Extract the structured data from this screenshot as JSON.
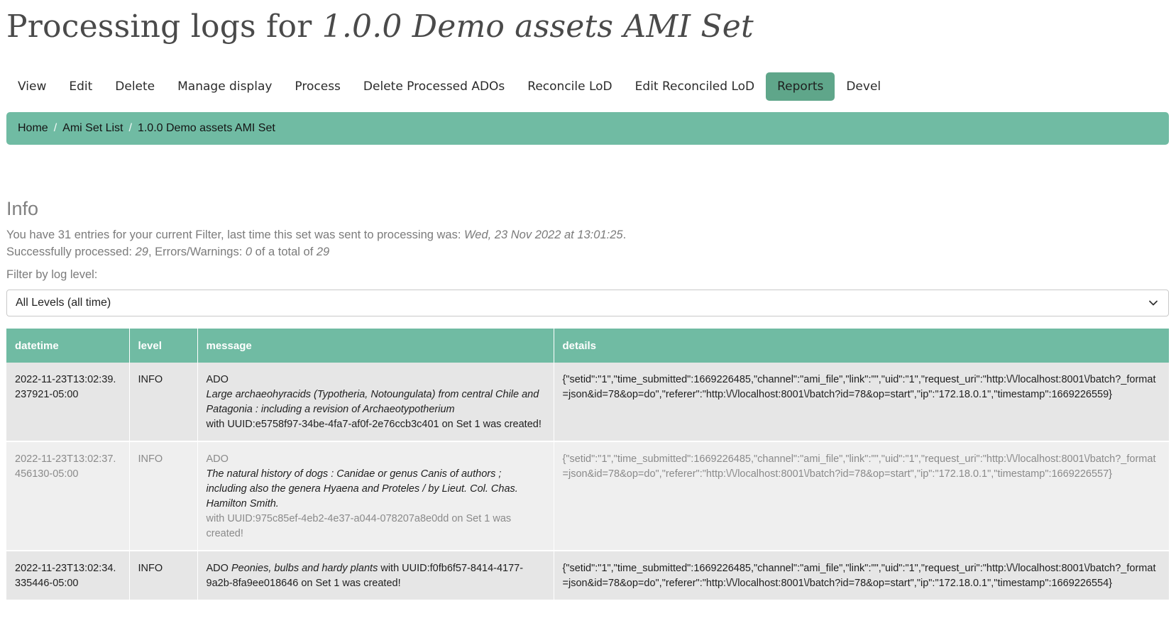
{
  "page": {
    "title_prefix": "Processing logs for ",
    "title_name": "1.0.0 Demo assets AMI Set"
  },
  "tabs": [
    {
      "label": "View"
    },
    {
      "label": "Edit"
    },
    {
      "label": "Delete"
    },
    {
      "label": "Manage display"
    },
    {
      "label": "Process"
    },
    {
      "label": "Delete Processed ADOs"
    },
    {
      "label": "Reconcile LoD"
    },
    {
      "label": "Edit Reconciled LoD"
    },
    {
      "label": "Reports",
      "active": true
    },
    {
      "label": "Devel"
    }
  ],
  "breadcrumb": {
    "items": [
      "Home",
      "Ami Set List",
      "1.0.0 Demo assets AMI Set"
    ],
    "separator": "/"
  },
  "info": {
    "heading": "Info",
    "line1_prefix": "You have 31 entries for your current Filter, last time this set was sent to processing was: ",
    "line1_date": "Wed, 23 Nov 2022 at 13:01:25",
    "line1_suffix": ".",
    "line2_prefix": "Successfully processed: ",
    "processed": "29",
    "line2_middle": ", Errors/Warnings: ",
    "errors": "0",
    "line2_of": " of a total of ",
    "total": "29"
  },
  "filter": {
    "label": "Filter by log level:",
    "selected": "All Levels (all time)"
  },
  "table": {
    "headers": {
      "datetime": "datetime",
      "level": "level",
      "message": "message",
      "details": "details"
    },
    "rows": [
      {
        "datetime": "2022-11-23T13:02:39.237921-05:00",
        "level": "INFO",
        "msg_before": "ADO",
        "msg_title": "Large archaeohyracids (Typotheria, Notoungulata) from central Chile and Patagonia : including a revision of Archaeotypotherium",
        "msg_after": "with UUID:e5758f97-34be-4fa7-af0f-2e76ccb3c401 on Set 1 was created!",
        "details": "{\"setid\":\"1\",\"time_submitted\":1669226485,\"channel\":\"ami_file\",\"link\":\"\",\"uid\":\"1\",\"request_uri\":\"http:\\/\\/localhost:8001\\/batch?_format=json&id=78&op=do\",\"referer\":\"http:\\/\\/localhost:8001\\/batch?id=78&op=start\",\"ip\":\"172.18.0.1\",\"timestamp\":1669226559}"
      },
      {
        "datetime": "2022-11-23T13:02:37.456130-05:00",
        "level": "INFO",
        "msg_before": "ADO",
        "msg_title": "The natural history of dogs : Canidae or genus Canis of authors ; including also the genera Hyaena and Proteles / by Lieut. Col. Chas. Hamilton Smith.",
        "msg_after": "with UUID:975c85ef-4eb2-4e37-a044-078207a8e0dd on Set 1 was created!",
        "details": "{\"setid\":\"1\",\"time_submitted\":1669226485,\"channel\":\"ami_file\",\"link\":\"\",\"uid\":\"1\",\"request_uri\":\"http:\\/\\/localhost:8001\\/batch?_format=json&id=78&op=do\",\"referer\":\"http:\\/\\/localhost:8001\\/batch?id=78&op=start\",\"ip\":\"172.18.0.1\",\"timestamp\":1669226557}"
      },
      {
        "datetime": "2022-11-23T13:02:34.335446-05:00",
        "level": "INFO",
        "msg_before": "ADO",
        "msg_title": "Peonies, bulbs and hardy plants",
        "msg_after": "with UUID:f0fb6f57-8414-4177-9a2b-8fa9ee018646 on Set 1 was created!",
        "details": "{\"setid\":\"1\",\"time_submitted\":1669226485,\"channel\":\"ami_file\",\"link\":\"\",\"uid\":\"1\",\"request_uri\":\"http:\\/\\/localhost:8001\\/batch?_format=json&id=78&op=do\",\"referer\":\"http:\\/\\/localhost:8001\\/batch?id=78&op=start\",\"ip\":\"172.18.0.1\",\"timestamp\":1669226554}"
      }
    ]
  },
  "icons": {
    "select_chevron": "chevron-down-icon"
  },
  "colors": {
    "accent": "#70bba3",
    "active_tab": "#5fa68a"
  }
}
